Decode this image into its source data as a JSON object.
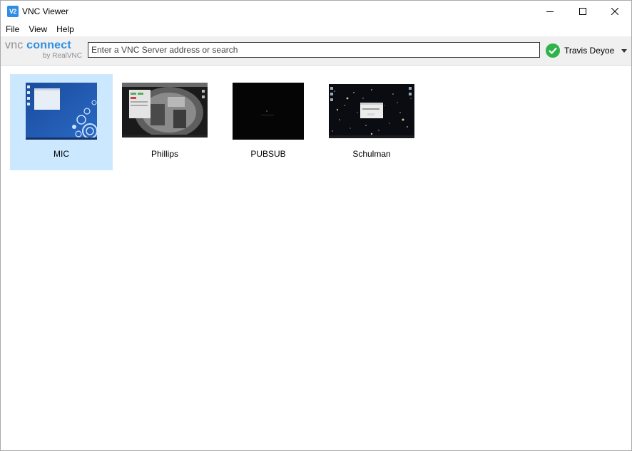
{
  "window": {
    "title": "VNC Viewer",
    "app_icon_text": "V2"
  },
  "menubar": {
    "items": [
      {
        "label": "File"
      },
      {
        "label": "View"
      },
      {
        "label": "Help"
      }
    ]
  },
  "toolbar": {
    "logo_line1_a": "vnc",
    "logo_line1_b": "connect",
    "logo_line2": "by RealVNC",
    "search_placeholder": "Enter a VNC Server address or search",
    "user_name": "Travis Deyoe"
  },
  "connections": [
    {
      "name": "MIC",
      "selected": true,
      "thumbnail": "blue-desktop"
    },
    {
      "name": "Phillips",
      "selected": false,
      "thumbnail": "camera-desktop"
    },
    {
      "name": "PUBSUB",
      "selected": false,
      "thumbnail": "black-screen"
    },
    {
      "name": "Schulman",
      "selected": false,
      "thumbnail": "space-desktop"
    }
  ],
  "colors": {
    "accent": "#2f8ee4",
    "selection": "#cce8ff",
    "status_ok": "#2fb34a"
  }
}
